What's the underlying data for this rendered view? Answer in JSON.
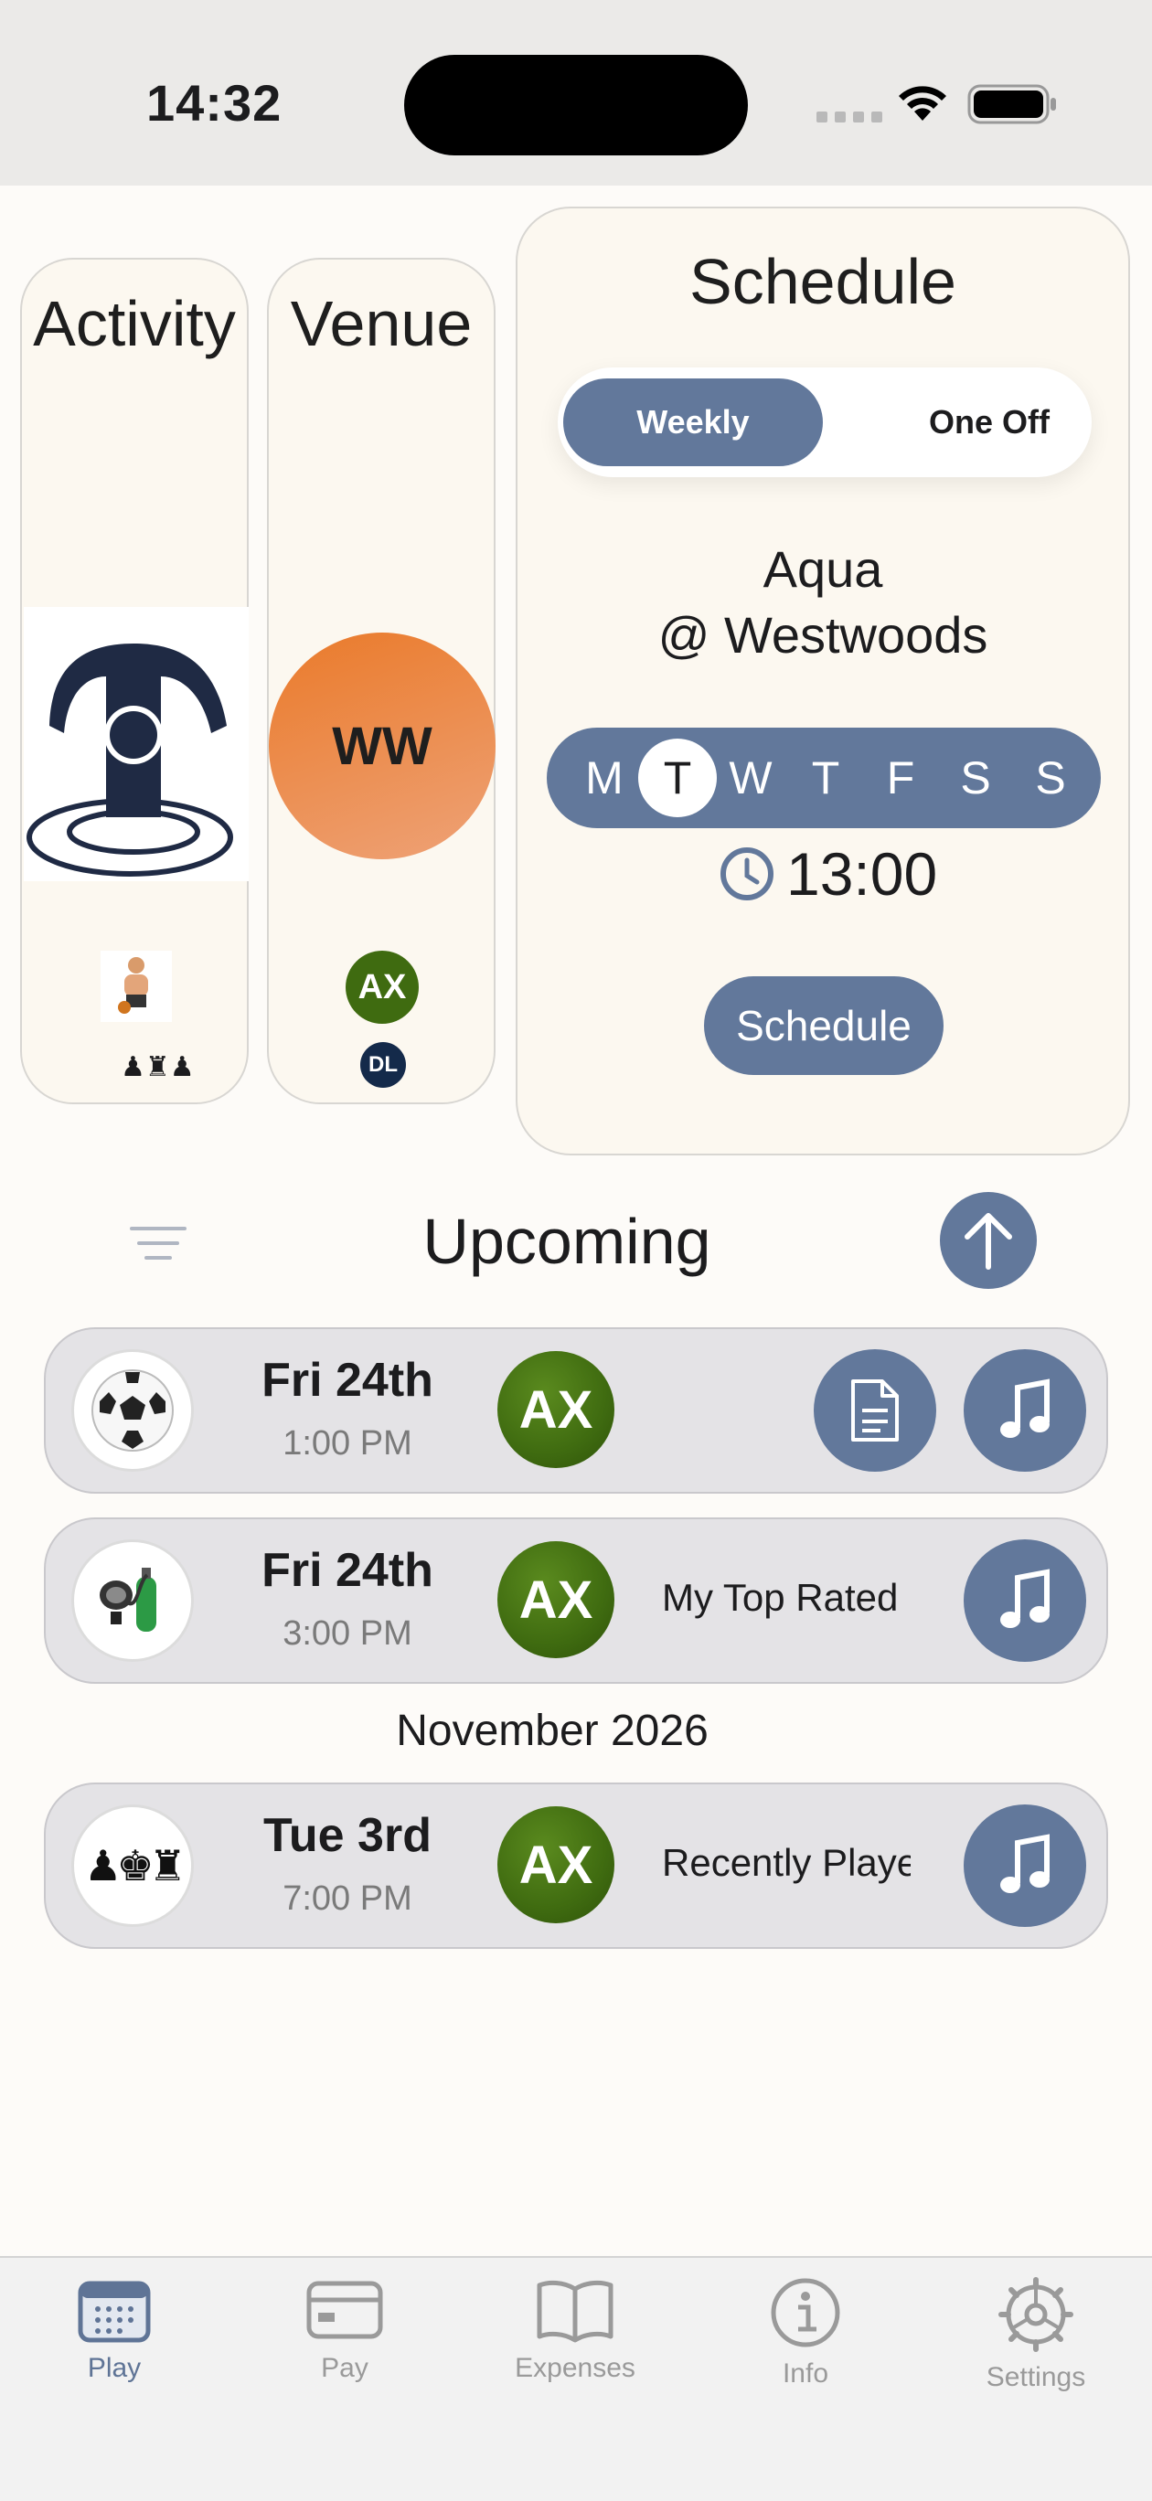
{
  "status_bar": {
    "time": "14:32"
  },
  "activity_card": {
    "title": "Activity"
  },
  "venue_card": {
    "title": "Venue",
    "initials": "WW",
    "avatars": [
      "AX",
      "DL"
    ]
  },
  "schedule": {
    "title": "Schedule",
    "segments": [
      "Weekly",
      "One Off"
    ],
    "selected_segment": "Weekly",
    "activity_line": "Aqua",
    "venue_line": "@ Westwoods",
    "days": [
      "M",
      "T",
      "W",
      "T",
      "F",
      "S",
      "S"
    ],
    "selected_day_index": 1,
    "time": "13:00",
    "button_label": "Schedule"
  },
  "upcoming": {
    "title": "Upcoming",
    "events": [
      {
        "date": "Fri 24th",
        "time": "1:00 PM",
        "avatar": "AX",
        "playlist": "",
        "icon": "soccer-ball-icon"
      },
      {
        "date": "Fri 24th",
        "time": "3:00 PM",
        "avatar": "AX",
        "playlist": "My Top Rated",
        "icon": "scuba-icon"
      },
      {
        "date": "Tue 3rd",
        "time": "7:00 PM",
        "avatar": "AX",
        "playlist": "Recently Played",
        "icon": "chess-icon"
      }
    ],
    "month_separator": "November 2026"
  },
  "tab_bar": {
    "tabs": [
      {
        "label": "Play",
        "icon": "calendar-icon",
        "active": true
      },
      {
        "label": "Pay",
        "icon": "credit-card-icon",
        "active": false
      },
      {
        "label": "Expenses",
        "icon": "book-icon",
        "active": false
      },
      {
        "label": "Info",
        "icon": "info-icon",
        "active": false
      },
      {
        "label": "Settings",
        "icon": "gear-icon",
        "active": false
      }
    ]
  },
  "colors": {
    "accent": "#62789b",
    "card_background": "#fcf8f0",
    "venue_orange": "#ea7a2a",
    "avatar_green": "#3f6b10",
    "row_background": "#e4e3e6"
  }
}
